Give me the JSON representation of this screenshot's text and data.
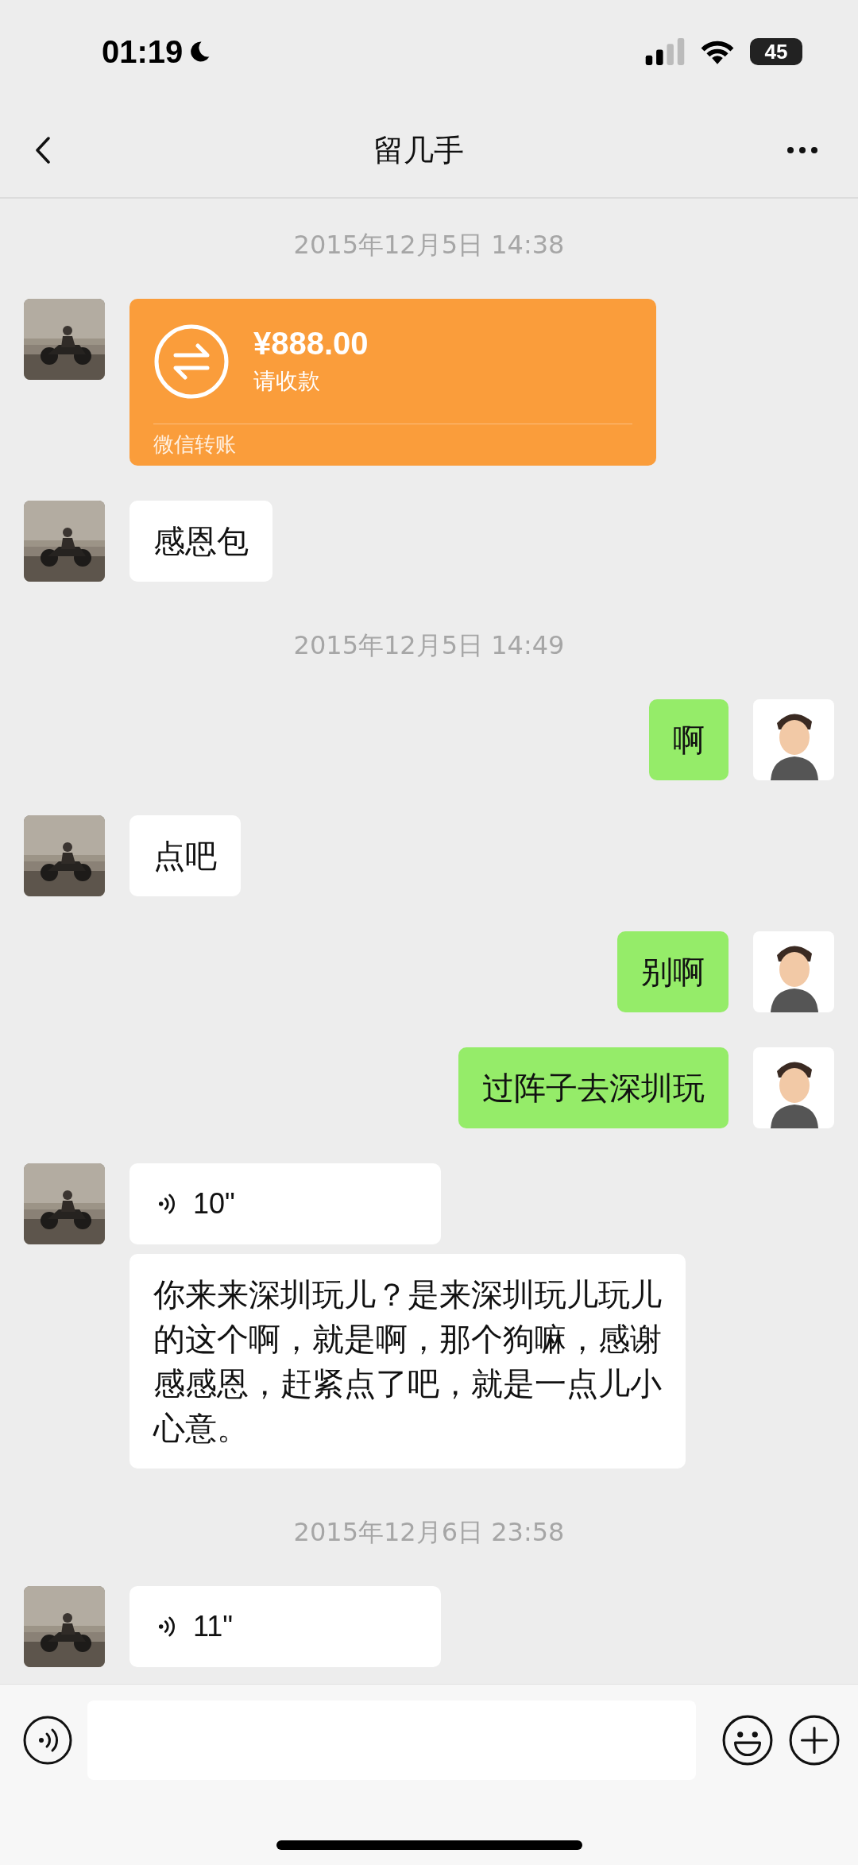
{
  "status_bar": {
    "time": "01:19",
    "battery": "45"
  },
  "nav": {
    "title": "留几手"
  },
  "messages": [
    {
      "kind": "time",
      "text": "2015年12月5日 14:38"
    },
    {
      "kind": "transfer",
      "outgoing": false,
      "show_avatar": true,
      "amount": "¥888.00",
      "note": "请收款",
      "footer": "微信转账"
    },
    {
      "kind": "text",
      "outgoing": false,
      "show_avatar": true,
      "text": "感恩包"
    },
    {
      "kind": "time",
      "text": "2015年12月5日 14:49"
    },
    {
      "kind": "text",
      "outgoing": true,
      "show_avatar": true,
      "text": "啊"
    },
    {
      "kind": "text",
      "outgoing": false,
      "show_avatar": true,
      "text": "点吧"
    },
    {
      "kind": "text",
      "outgoing": true,
      "show_avatar": true,
      "text": "别啊"
    },
    {
      "kind": "text",
      "outgoing": true,
      "show_avatar": true,
      "text": "过阵子去深圳玩"
    },
    {
      "kind": "voice",
      "outgoing": false,
      "show_avatar": true,
      "duration": "10\""
    },
    {
      "kind": "text",
      "outgoing": false,
      "show_avatar": false,
      "text": "你来来深圳玩儿？是来深圳玩儿玩儿的这个啊，就是啊，那个狗嘛，感谢感感恩，赶紧点了吧，就是一点儿小心意。"
    },
    {
      "kind": "time",
      "text": "2015年12月6日 23:58"
    },
    {
      "kind": "voice",
      "outgoing": false,
      "show_avatar": true,
      "duration": "11\""
    }
  ]
}
